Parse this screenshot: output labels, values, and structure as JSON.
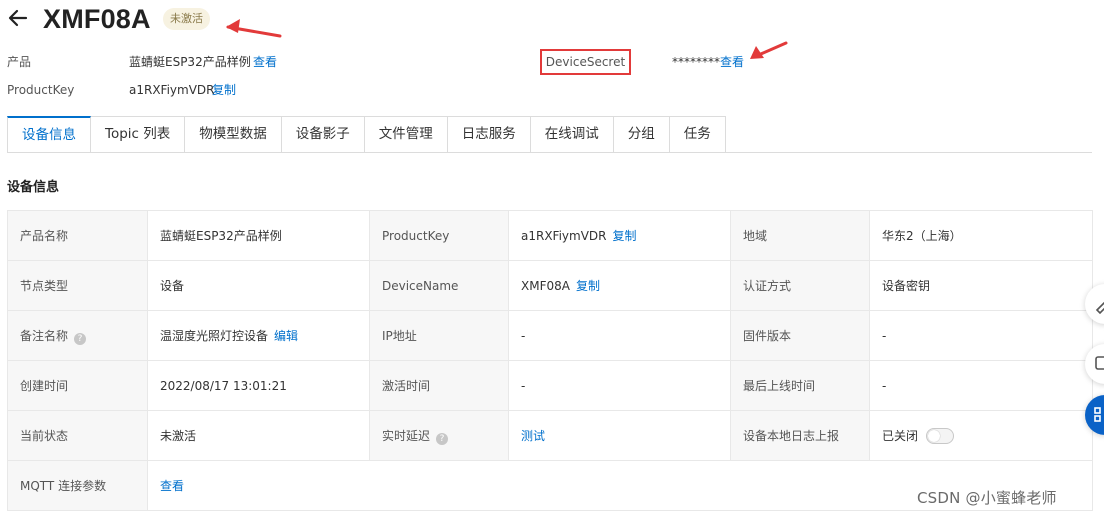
{
  "header": {
    "device_name": "XMF08A",
    "status_badge": "未激活"
  },
  "meta": {
    "product_label": "产品",
    "product_value": "蓝蜻蜓ESP32产品样例",
    "product_link": "查看",
    "productkey_label": "ProductKey",
    "productkey_value": "a1RXFiymVDR",
    "productkey_link": "复制",
    "devicesecret_label": "DeviceSecret",
    "devicesecret_value": "********",
    "devicesecret_link": "查看"
  },
  "tabs": [
    {
      "label": "设备信息",
      "active": true
    },
    {
      "label": "Topic 列表"
    },
    {
      "label": "物模型数据"
    },
    {
      "label": "设备影子"
    },
    {
      "label": "文件管理"
    },
    {
      "label": "日志服务"
    },
    {
      "label": "在线调试"
    },
    {
      "label": "分组"
    },
    {
      "label": "任务"
    }
  ],
  "section_title": "设备信息",
  "info": {
    "product_name_label": "产品名称",
    "product_name_value": "蓝蜻蜓ESP32产品样例",
    "productkey_label": "ProductKey",
    "productkey_value": "a1RXFiymVDR",
    "copy_link": "复制",
    "region_label": "地域",
    "region_value": "华东2（上海）",
    "node_type_label": "节点类型",
    "node_type_value": "设备",
    "devicename_label": "DeviceName",
    "devicename_value": "XMF08A",
    "auth_label": "认证方式",
    "auth_value": "设备密钥",
    "remark_label": "备注名称",
    "remark_value": "温湿度光照灯控设备",
    "edit_link": "编辑",
    "ip_label": "IP地址",
    "ip_value": "-",
    "firmware_label": "固件版本",
    "firmware_value": "-",
    "created_label": "创建时间",
    "created_value": "2022/08/17 13:01:21",
    "activated_label": "激活时间",
    "activated_value": "-",
    "last_online_label": "最后上线时间",
    "last_online_value": "-",
    "status_label": "当前状态",
    "status_value": "未激活",
    "latency_label": "实时延迟",
    "latency_link": "测试",
    "local_log_label": "设备本地日志上报",
    "local_log_value": "已关闭",
    "mqtt_label": "MQTT 连接参数",
    "mqtt_link": "查看"
  },
  "help_glyph": "?",
  "watermark": "CSDN @小蜜蜂老师",
  "colors": {
    "link": "#0070cc",
    "annotation_red": "#e23a3a",
    "float_blue": "#0a62c7"
  }
}
